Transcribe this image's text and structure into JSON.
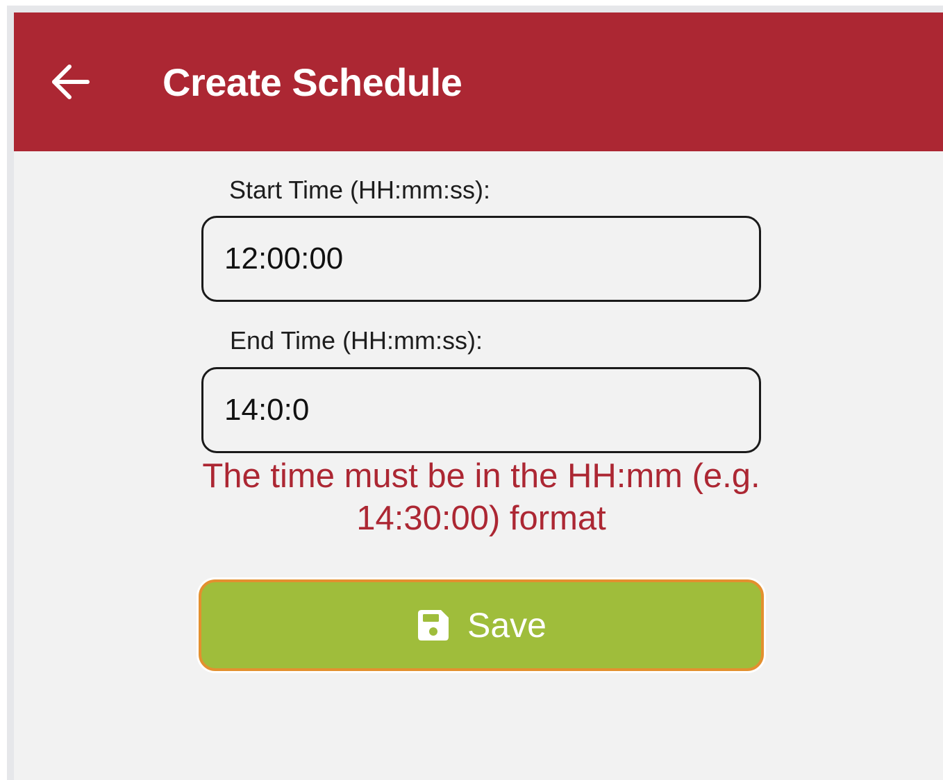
{
  "header": {
    "back_icon": "arrow-left-icon",
    "title": "Create Schedule",
    "background_color": "#ac2733"
  },
  "form": {
    "start_time": {
      "label": "Start Time (HH:mm:ss):",
      "value": "12:00:00"
    },
    "end_time": {
      "label": "End Time (HH:mm:ss):",
      "value": "14:0:0"
    },
    "error_message": "The time must be in the HH:mm (e.g. 14:30:00) format",
    "error_color": "#ac2733"
  },
  "save_button": {
    "icon": "floppy-disk-icon",
    "label": "Save",
    "background_color": "#9fbd3b",
    "border_color": "#e3902f"
  }
}
